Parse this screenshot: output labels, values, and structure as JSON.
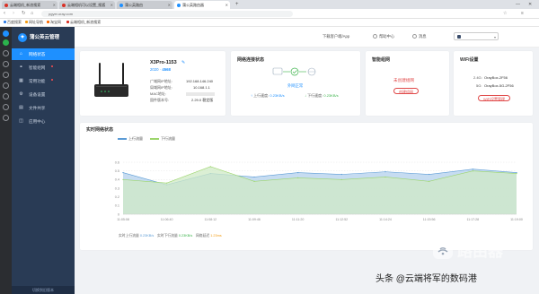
{
  "browser": {
    "tabs": [
      {
        "label": "云端相机_新浪搜索",
        "active": false,
        "color": "#d93025"
      },
      {
        "label": "云端相机可以设置_搜狐",
        "active": false,
        "color": "#d93025"
      },
      {
        "label": "蒲公英路由",
        "active": false,
        "color": "#1e90ff"
      },
      {
        "label": "蒲公英路由器",
        "active": true,
        "color": "#1e90ff"
      }
    ],
    "url": "pgyer.oray.com",
    "bookmarks": [
      "百度搜索",
      "网址导航",
      "淘宝网",
      "云端相机_新浪搜索"
    ]
  },
  "sidebar": {
    "brand": "蒲公英云管理",
    "items": [
      {
        "label": "网络状态",
        "icon": "home-icon",
        "glyph": "⌂",
        "active": true,
        "dot": false
      },
      {
        "label": "智能组网",
        "icon": "network-icon",
        "glyph": "⚭",
        "active": false,
        "dot": true
      },
      {
        "label": "常用功能",
        "icon": "grid-icon",
        "glyph": "▦",
        "active": false,
        "dot": true
      },
      {
        "label": "设备设置",
        "icon": "gear-icon",
        "glyph": "⚙",
        "active": false,
        "dot": false
      },
      {
        "label": "文件共享",
        "icon": "folder-icon",
        "glyph": "▤",
        "active": false,
        "dot": false
      },
      {
        "label": "应用中心",
        "icon": "apps-icon",
        "glyph": "◫",
        "active": false,
        "dot": false
      }
    ],
    "footer": "切换到旧版本"
  },
  "header": {
    "buttons": [
      "下载客户端/App",
      "帮助中心",
      "消息"
    ],
    "device_select": ""
  },
  "device": {
    "name": "X3Pro-1153",
    "badge_left": "2020",
    "badge_right": "4568",
    "fields": [
      {
        "label": "广域网IP地址:",
        "value": "192.168.146.240"
      },
      {
        "label": "局域网IP地址:",
        "value": "10.168.1.1"
      },
      {
        "label": "MAC地址:",
        "value": ""
      },
      {
        "label": "固件版本号:",
        "value": "2.29.0 稳定版"
      }
    ]
  },
  "network_status": {
    "title": "网络连接状态",
    "status": "外网正常",
    "upload_label": "上行速度:",
    "upload_value": "0.23KB/s",
    "download_label": "下行速度:",
    "download_value": "0.23KB/s"
  },
  "smart_network": {
    "title": "智能组网",
    "status": "未创建组网",
    "button": "创建组网"
  },
  "wifi": {
    "title": "WiFi设置",
    "ssid_24_label": "2.4G:",
    "ssid_24": "OrayBox-2F56",
    "ssid_5_label": "5G:",
    "ssid_5": "OrayBox-5G-2F56",
    "button": "WiFi设置管理"
  },
  "colors": {
    "upload": "#5b9bd5",
    "download": "#9cd56b",
    "active_nav": "#1e90ff",
    "sidebar": "#293b55",
    "danger": "#e04848"
  },
  "chart_data": {
    "type": "area",
    "title": "实时网络状态",
    "x": [
      "11:05:08",
      "11:06:40",
      "11:08:12",
      "11:09:46",
      "11:11:20",
      "11:12:52",
      "11:14:24",
      "11:15:56",
      "11:17:28",
      "11:19:00"
    ],
    "series": [
      {
        "name": "上行流量",
        "values": [
          0.48,
          0.34,
          0.47,
          0.43,
          0.48,
          0.46,
          0.49,
          0.46,
          0.52,
          0.48
        ]
      },
      {
        "name": "下行流量",
        "values": [
          0.4,
          0.36,
          0.55,
          0.38,
          0.42,
          0.4,
          0.43,
          0.38,
          0.5,
          0.47
        ]
      }
    ],
    "ylim": [
      0,
      0.6
    ],
    "yticks": [
      "0",
      "0.1",
      "0.2",
      "0.3",
      "0.4",
      "0.5",
      "0.6"
    ],
    "grid": true,
    "legend_position": "top-left",
    "footer": [
      {
        "label": "实时上行流量",
        "value": "0.23KB/s"
      },
      {
        "label": "实时下行流量",
        "value": "0.23KB/s"
      },
      {
        "label": "网络延迟",
        "value": "1.23ms"
      }
    ]
  },
  "watermark": {
    "logo_text": "路由器",
    "caption": "头条 @云端将军的数码港"
  }
}
